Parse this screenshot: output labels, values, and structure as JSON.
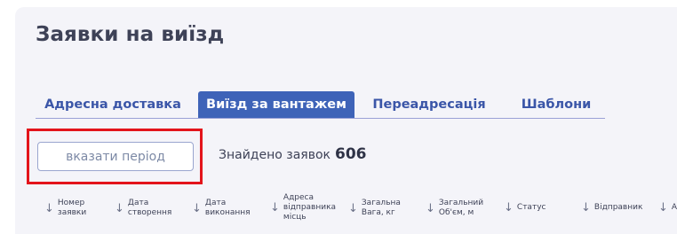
{
  "page": {
    "title": "Заявки на виїзд"
  },
  "tabs": [
    {
      "label": "Адресна доставка",
      "active": false
    },
    {
      "label": "Виїзд за вантажем",
      "active": true
    },
    {
      "label": "Переадресація",
      "active": false
    },
    {
      "label": "Шаблони",
      "active": false
    }
  ],
  "filter": {
    "period_label": "вказати період"
  },
  "results": {
    "found_label": "Знайдено заявок",
    "found_count": "606"
  },
  "table": {
    "columns": [
      {
        "label": "Номер заявки",
        "sort_icon": "arrow-down-icon"
      },
      {
        "label": "Дата створення",
        "sort_icon": "arrow-down-icon"
      },
      {
        "label": "Дата виконання",
        "sort_icon": "arrow-down-icon"
      },
      {
        "label": "Адреса відправника місць",
        "sort_icon": "arrow-down-icon"
      },
      {
        "label": "Загальна Вага, кг",
        "sort_icon": "arrow-down-icon"
      },
      {
        "label": "Загальний Об'єм, м",
        "sort_icon": "arrow-down-icon"
      },
      {
        "label": "Статус",
        "sort_icon": "arrow-down-icon"
      },
      {
        "label": "Відправник",
        "sort_icon": "arrow-down-icon"
      },
      {
        "label": "А",
        "sort_icon": "arrow-down-icon"
      }
    ]
  },
  "colors": {
    "accent": "#3e63b8",
    "tab_text": "#3b56a8",
    "highlight": "#e3141b",
    "panel_bg": "#f4f4f9"
  }
}
